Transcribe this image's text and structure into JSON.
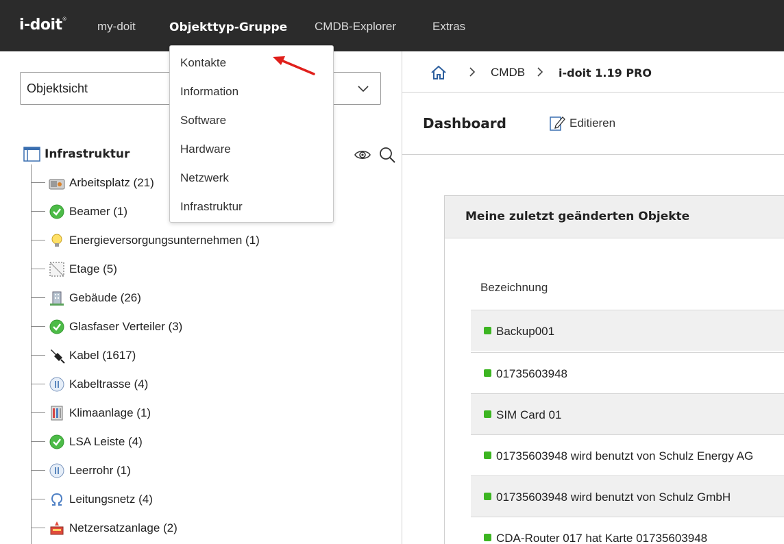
{
  "app": {
    "logo": "i-doit",
    "logo_mark": "®"
  },
  "nav": {
    "items": [
      {
        "label": "my-doit",
        "active": false
      },
      {
        "label": "Objekttyp-Gruppe",
        "active": true
      },
      {
        "label": "CMDB-Explorer",
        "active": false
      },
      {
        "label": "Extras",
        "active": false
      }
    ]
  },
  "dropdown": {
    "items": [
      "Kontakte",
      "Information",
      "Software",
      "Hardware",
      "Netzwerk",
      "Infrastruktur"
    ]
  },
  "sidebar": {
    "view_select": {
      "value": "Objektsicht"
    },
    "root": {
      "label": "Infrastruktur",
      "icon": "window-icon"
    },
    "items": [
      {
        "label": "Arbeitsplatz (21)",
        "icon": "workstation-icon"
      },
      {
        "label": "Beamer (1)",
        "icon": "green-check-icon"
      },
      {
        "label": "Energieversorgungsunternehmen (1)",
        "icon": "lightbulb-icon"
      },
      {
        "label": "Etage (5)",
        "icon": "floor-plan-icon"
      },
      {
        "label": "Gebäude (26)",
        "icon": "building-icon"
      },
      {
        "label": "Glasfaser Verteiler (3)",
        "icon": "green-check-icon"
      },
      {
        "label": "Kabel (1617)",
        "icon": "cable-plug-icon"
      },
      {
        "label": "Kabeltrasse (4)",
        "icon": "cable-tray-icon"
      },
      {
        "label": "Klimaanlage (1)",
        "icon": "air-conditioner-icon"
      },
      {
        "label": "LSA Leiste (4)",
        "icon": "green-check-icon"
      },
      {
        "label": "Leerrohr (1)",
        "icon": "conduit-icon"
      },
      {
        "label": "Leitungsnetz (4)",
        "icon": "omega-icon"
      },
      {
        "label": "Netzersatzanlage (2)",
        "icon": "generator-icon"
      }
    ]
  },
  "breadcrumb": {
    "items": [
      "CMDB",
      "i-doit 1.19 PRO"
    ]
  },
  "page": {
    "title": "Dashboard",
    "edit_label": "Editieren"
  },
  "widget": {
    "title": "Meine zuletzt geänderten Objekte",
    "column_header": "Bezeichnung",
    "status_color": "#3cb521",
    "rows": [
      "Backup001",
      "01735603948",
      "SIM Card 01",
      "01735603948 wird benutzt von Schulz Energy AG",
      "01735603948 wird benutzt von Schulz GmbH",
      "CDA-Router 017 hat Karte 01735603948"
    ]
  },
  "colors": {
    "topbar": "#2b2b2b",
    "accent_arrow": "#e0201c",
    "status_green": "#3cb521"
  }
}
